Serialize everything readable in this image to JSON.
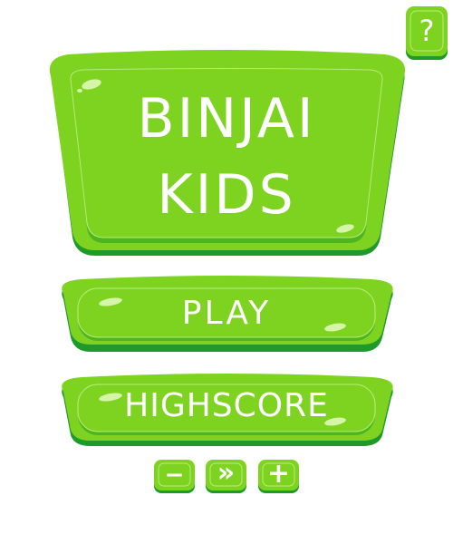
{
  "title": {
    "line1": "BINJAI",
    "line2": "KIDS"
  },
  "buttons": {
    "play": "PLAY",
    "highscore": "HIGHSCORE",
    "help": "?",
    "minus": "−",
    "next": "»",
    "plus": "+"
  },
  "colors": {
    "green": "#7ed321",
    "green_dark": "#4db51f",
    "green_bottom": "#1e9a2a",
    "highlight": "#d7f5a8"
  }
}
